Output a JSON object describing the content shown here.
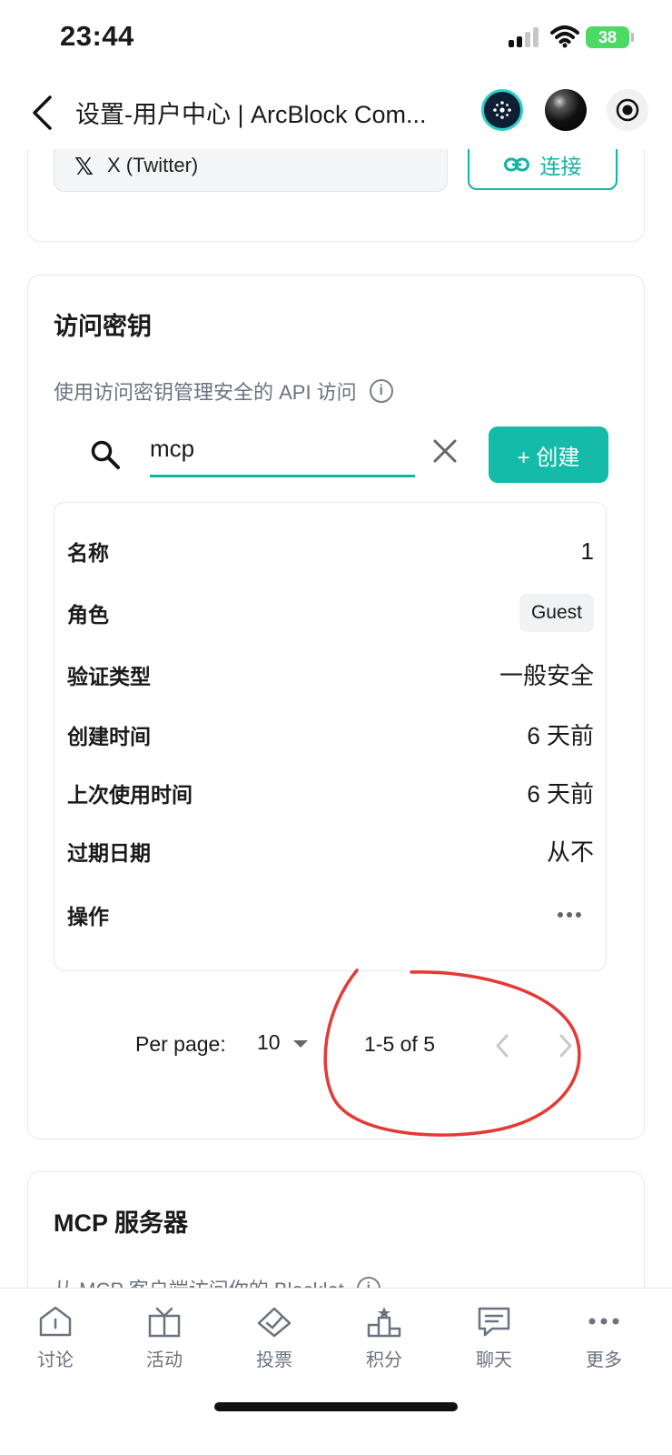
{
  "status_bar": {
    "time": "23:44",
    "battery": "38"
  },
  "nav": {
    "title": "设置-用户中心 | ArcBlock Com..."
  },
  "connections": {
    "item_label": "X (Twitter)",
    "connect_label": "连接"
  },
  "access_keys": {
    "title": "访问密钥",
    "description": "使用访问密钥管理安全的 API 访问",
    "search_value": "mcp",
    "create_label": "+ 创建",
    "rows": [
      {
        "label": "名称",
        "value": "1"
      },
      {
        "label": "角色",
        "value": "Guest"
      },
      {
        "label": "验证类型",
        "value": "一般安全"
      },
      {
        "label": "创建时间",
        "value": "6 天前"
      },
      {
        "label": "上次使用时间",
        "value": "6 天前"
      },
      {
        "label": "过期日期",
        "value": "从不"
      },
      {
        "label": "操作",
        "value": ""
      }
    ],
    "pagination": {
      "per_page_label": "Per page:",
      "per_page_value": "10",
      "range": "1-5 of 5"
    }
  },
  "mcp": {
    "title": "MCP 服务器",
    "description": "从 MCP 客户端访问你的 Blocklet"
  },
  "tabs": [
    {
      "label": "讨论",
      "icon": "home-icon"
    },
    {
      "label": "活动",
      "icon": "gift-icon"
    },
    {
      "label": "投票",
      "icon": "vote-icon"
    },
    {
      "label": "积分",
      "icon": "podium-icon"
    },
    {
      "label": "聊天",
      "icon": "chat-icon"
    },
    {
      "label": "更多",
      "icon": "more-icon"
    }
  ],
  "colors": {
    "accent": "#14bba8",
    "annotation": "#e53935",
    "battery": "#4cd964"
  }
}
